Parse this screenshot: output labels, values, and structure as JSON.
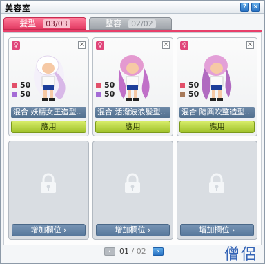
{
  "window": {
    "title": "美容室",
    "btn_help": "?",
    "btn_close": "×"
  },
  "tabs": [
    {
      "label": "髮型",
      "current": "03",
      "sep": "/",
      "total": "03"
    },
    {
      "label": "整容",
      "current": "02",
      "sep": "/",
      "total": "02"
    }
  ],
  "colors": {
    "accent": "#e8406a",
    "apply": "#b5d63a",
    "locked_button": "#6886a8"
  },
  "slots": [
    {
      "gender": "♀",
      "close": "×",
      "stats": [
        {
          "value": "50",
          "color": "#e2506a"
        },
        {
          "value": "50",
          "color": "#a56cd6"
        }
      ],
      "name": "混合 妖精女王造型..",
      "button": "應用",
      "hair": [
        "#ffffff",
        "#d8b8e8"
      ]
    },
    {
      "gender": "♀",
      "close": "×",
      "stats": [
        {
          "value": "50",
          "color": "#e2506a"
        },
        {
          "value": "50",
          "color": "#a56cd6"
        }
      ],
      "name": "混合 活潑波浪髮型..",
      "button": "應用",
      "hair": [
        "#e49ad0",
        "#c070c8"
      ]
    },
    {
      "gender": "♀",
      "close": "×",
      "stats": [
        {
          "value": "50",
          "color": "#e2506a"
        },
        {
          "value": "50",
          "color": "#a77a5a"
        }
      ],
      "name": "混合 隨興吹整造型..",
      "button": "應用",
      "hair": [
        "#e3a0d8",
        "#b06ac0"
      ]
    }
  ],
  "locked_slots": [
    {
      "icon": "lock-icon",
      "button": "增加欄位",
      "chevron": "›"
    },
    {
      "icon": "lock-icon",
      "button": "增加欄位",
      "chevron": "›"
    },
    {
      "icon": "lock-icon",
      "button": "增加欄位",
      "chevron": "›"
    }
  ],
  "pager": {
    "current": "01",
    "sep": "/",
    "total": "02",
    "prev": "‹",
    "next": "›"
  },
  "watermark": "僧侶"
}
